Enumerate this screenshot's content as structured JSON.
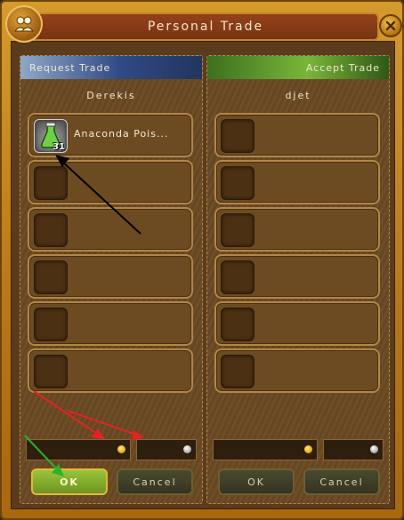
{
  "window": {
    "title": "Personal Trade"
  },
  "icons": {
    "friends": "friends-icon",
    "close": "close-icon",
    "gold_coin": "gold-coin-icon",
    "silver_coin": "silver-coin-icon",
    "item": "potion-icon"
  },
  "left_panel": {
    "header": "Request Trade",
    "player": "Derekis",
    "slots": [
      {
        "item_name": "Anaconda Pois...",
        "count": "31"
      },
      {
        "item_name": "",
        "count": ""
      },
      {
        "item_name": "",
        "count": ""
      },
      {
        "item_name": "",
        "count": ""
      },
      {
        "item_name": "",
        "count": ""
      },
      {
        "item_name": "",
        "count": ""
      }
    ],
    "gold": "",
    "silver": "",
    "ok_label": "OK",
    "cancel_label": "Cancel"
  },
  "right_panel": {
    "header": "Accept Trade",
    "player": "djet",
    "gold": "",
    "silver": "",
    "ok_label": "OK",
    "cancel_label": "Cancel"
  },
  "colors": {
    "annotation_black": "#000000",
    "annotation_red": "#e52222",
    "annotation_green": "#2bb32b"
  }
}
